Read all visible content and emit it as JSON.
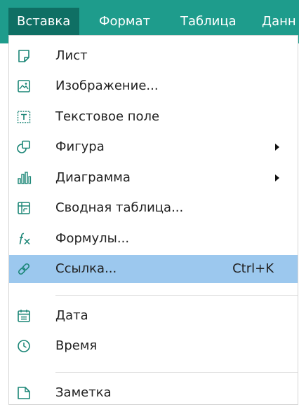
{
  "menubar": {
    "tabs": [
      {
        "label": "Вставка",
        "active": true
      },
      {
        "label": "Формат",
        "active": false
      },
      {
        "label": "Таблица",
        "active": false
      },
      {
        "label": "Данн",
        "active": false
      }
    ]
  },
  "dropdown": {
    "items": [
      {
        "label": "Лист",
        "icon": "sheet-icon"
      },
      {
        "label": "Изображение...",
        "icon": "image-icon"
      },
      {
        "label": "Текстовое поле",
        "icon": "textbox-icon"
      },
      {
        "label": "Фигура",
        "icon": "shape-icon",
        "submenu": true
      },
      {
        "label": "Диаграмма",
        "icon": "chart-icon",
        "submenu": true
      },
      {
        "label": "Сводная таблица...",
        "icon": "pivot-table-icon"
      },
      {
        "label": "Формулы...",
        "icon": "formula-icon"
      },
      {
        "label": "Ссылка...",
        "icon": "link-icon",
        "shortcut": "Ctrl+K",
        "selected": true
      },
      {
        "label": "Дата",
        "icon": "calendar-icon"
      },
      {
        "label": "Время",
        "icon": "clock-icon"
      },
      {
        "label": "Заметка",
        "icon": "note-icon"
      }
    ]
  },
  "colors": {
    "menubar": "#1e9c8c",
    "active_tab": "#0f6f64",
    "selected_item": "#9cc8ee",
    "icon": "#1a8576"
  }
}
